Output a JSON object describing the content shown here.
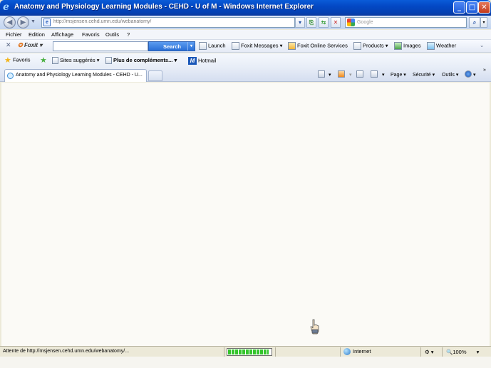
{
  "window": {
    "title": "Anatomy and Physiology Learning Modules - CEHD - U of M - Windows Internet Explorer",
    "controls": {
      "minimize": "_",
      "maximize": "□",
      "close": "✕"
    }
  },
  "address_bar": {
    "url": "http://msjensen.cehd.umn.edu/webanatomy/",
    "search_placeholder": "Google"
  },
  "menu": [
    "Fichier",
    "Edition",
    "Affichage",
    "Favoris",
    "Outils",
    "?"
  ],
  "foxit_toolbar": {
    "close": "✕",
    "brand": "Foxit",
    "search_button": "Search",
    "items": [
      "Launch",
      "Foxit Messages",
      "Foxit Online Services",
      "Products",
      "Images",
      "Weather"
    ]
  },
  "favorites_bar": {
    "favorites_label": "Favoris",
    "suggested_sites": "Sites suggérés",
    "more_addons": "Plus de compléments...",
    "hotmail": "Hotmail"
  },
  "tabs": [
    {
      "label": "Anatomy and Physiology Learning Modules - CEHD - U..."
    }
  ],
  "command_bar": [
    "Page",
    "Sécurité",
    "Outils"
  ],
  "status_bar": {
    "status_text": "Attente de http://msjensen.cehd.umn.edu/webanatomy/...",
    "progress": 0.95,
    "zone": "Internet",
    "zoom": "100%"
  }
}
